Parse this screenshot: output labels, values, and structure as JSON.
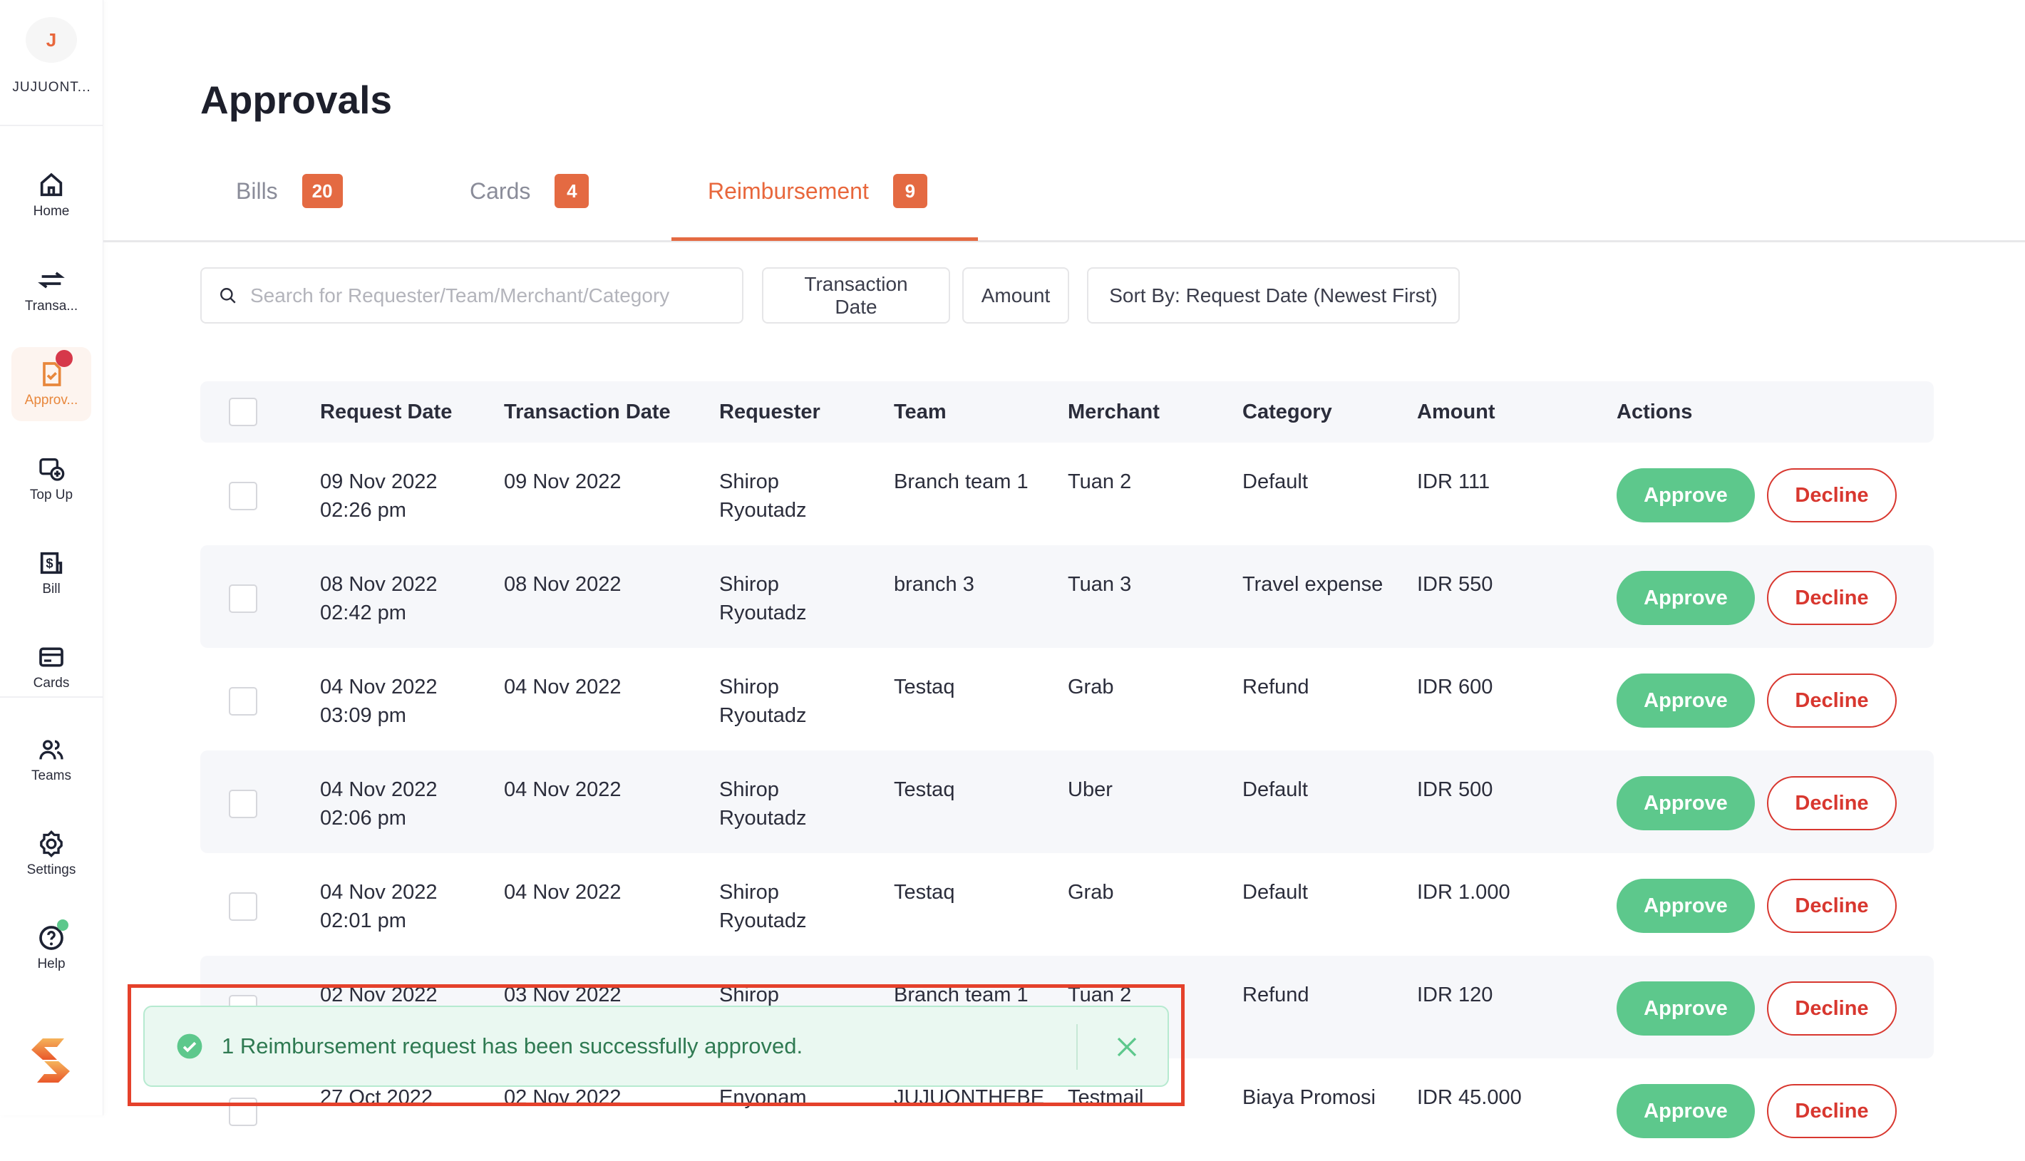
{
  "sidebar": {
    "avatar_initial": "J",
    "org_name": "JUJUONT...",
    "items": [
      {
        "label": "Home",
        "icon": "home-icon"
      },
      {
        "label": "Transa...",
        "icon": "transfer-icon"
      },
      {
        "label": "Approv...",
        "icon": "approval-icon",
        "active": true,
        "notification": true
      },
      {
        "label": "Top Up",
        "icon": "top-up-icon"
      },
      {
        "label": "Bill",
        "icon": "bill-icon"
      },
      {
        "label": "Cards",
        "icon": "card-icon"
      },
      {
        "label": "Teams",
        "icon": "teams-icon"
      },
      {
        "label": "Settings",
        "icon": "gear-icon"
      },
      {
        "label": "Help",
        "icon": "help-icon",
        "online": true
      }
    ]
  },
  "page": {
    "title": "Approvals"
  },
  "tabs": [
    {
      "label": "Bills",
      "count": "20"
    },
    {
      "label": "Cards",
      "count": "4"
    },
    {
      "label": "Reimbursement",
      "count": "9",
      "active": true
    }
  ],
  "filters": {
    "search_placeholder": "Search for Requester/Team/Merchant/Category",
    "search_value": "",
    "transaction_date": "Transaction Date",
    "amount": "Amount",
    "sort": "Sort By: Request Date (Newest First)"
  },
  "table": {
    "headers": [
      "Request Date",
      "Transaction Date",
      "Requester",
      "Team",
      "Merchant",
      "Category",
      "Amount",
      "Actions"
    ],
    "approve_label": "Approve",
    "decline_label": "Decline",
    "rows": [
      {
        "req_date": "09 Nov 2022",
        "req_time": "02:26 pm",
        "tx_date": "09 Nov 2022",
        "requester_first": "Shirop",
        "requester_last": "Ryoutadz",
        "team": "Branch team 1",
        "merchant": "Tuan 2",
        "category": "Default",
        "amount": "IDR 111"
      },
      {
        "req_date": "08 Nov 2022",
        "req_time": "02:42 pm",
        "tx_date": "08 Nov 2022",
        "requester_first": "Shirop",
        "requester_last": "Ryoutadz",
        "team": "branch 3",
        "merchant": "Tuan 3",
        "category": "Travel expense",
        "amount": "IDR 550"
      },
      {
        "req_date": "04 Nov 2022",
        "req_time": "03:09 pm",
        "tx_date": "04 Nov 2022",
        "requester_first": "Shirop",
        "requester_last": "Ryoutadz",
        "team": "Testaq",
        "merchant": "Grab",
        "category": "Refund",
        "amount": "IDR 600"
      },
      {
        "req_date": "04 Nov 2022",
        "req_time": "02:06 pm",
        "tx_date": "04 Nov 2022",
        "requester_first": "Shirop",
        "requester_last": "Ryoutadz",
        "team": "Testaq",
        "merchant": "Uber",
        "category": "Default",
        "amount": "IDR 500"
      },
      {
        "req_date": "04 Nov 2022",
        "req_time": "02:01 pm",
        "tx_date": "04 Nov 2022",
        "requester_first": "Shirop",
        "requester_last": "Ryoutadz",
        "team": "Testaq",
        "merchant": "Grab",
        "category": "Default",
        "amount": "IDR 1.000"
      },
      {
        "req_date": "02 Nov 2022",
        "req_time": "",
        "tx_date": "03 Nov 2022",
        "requester_first": "Shirop",
        "requester_last": "",
        "team": "Branch team 1",
        "merchant": "Tuan 2",
        "category": "Refund",
        "amount": "IDR 120"
      },
      {
        "req_date": "27 Oct 2022",
        "req_time": "",
        "tx_date": "02 Nov 2022",
        "requester_first": "Enyonam",
        "requester_last": "",
        "team": "JUJUONTHEBE",
        "merchant": "Testmail",
        "category": "Biaya Promosi",
        "amount": "IDR 45.000"
      }
    ]
  },
  "toast": {
    "message": "1 Reimbursement request has been successfully approved.",
    "type": "success"
  },
  "colors": {
    "accent": "#e46a42",
    "approve": "#5dc88c",
    "decline": "#d8372f",
    "toast_bg": "#eaf8f1",
    "highlight": "#e5412b"
  }
}
